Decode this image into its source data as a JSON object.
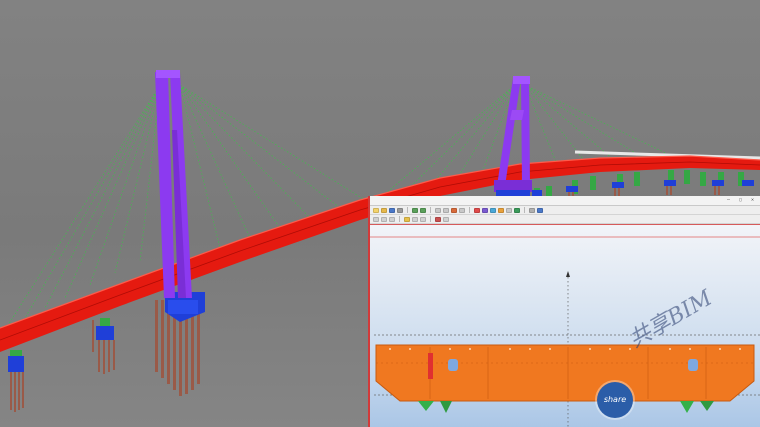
{
  "viewport": {
    "label": "bridge-3d-model-view",
    "colors": {
      "background": "#7b7b7b",
      "deck": "#e51a10",
      "tower": "#8c3af0",
      "pile_cap": "#1f3fd8",
      "pile": "#9a5a48",
      "cable": "#3fbf4a",
      "pier": "#35a845"
    }
  },
  "app_window": {
    "title": "",
    "window_buttons": "— ▢ ✕",
    "toolbar_icons": [
      "file-icon",
      "open-icon",
      "save-icon",
      "print-icon",
      "undo-icon",
      "redo-icon",
      "zoom-icon",
      "pan-icon",
      "rotate-icon",
      "select-icon",
      "measure-icon",
      "layer-icon",
      "view-icon",
      "render-icon",
      "grid-icon",
      "snap-icon",
      "settings-icon",
      "help-icon"
    ],
    "canvas": {
      "section_color": "#f07820",
      "section_outline": "#c85a10",
      "guide_line_color": "#6a6a6a"
    }
  },
  "watermark": {
    "badge_text": "share",
    "text": "共享BIM"
  }
}
